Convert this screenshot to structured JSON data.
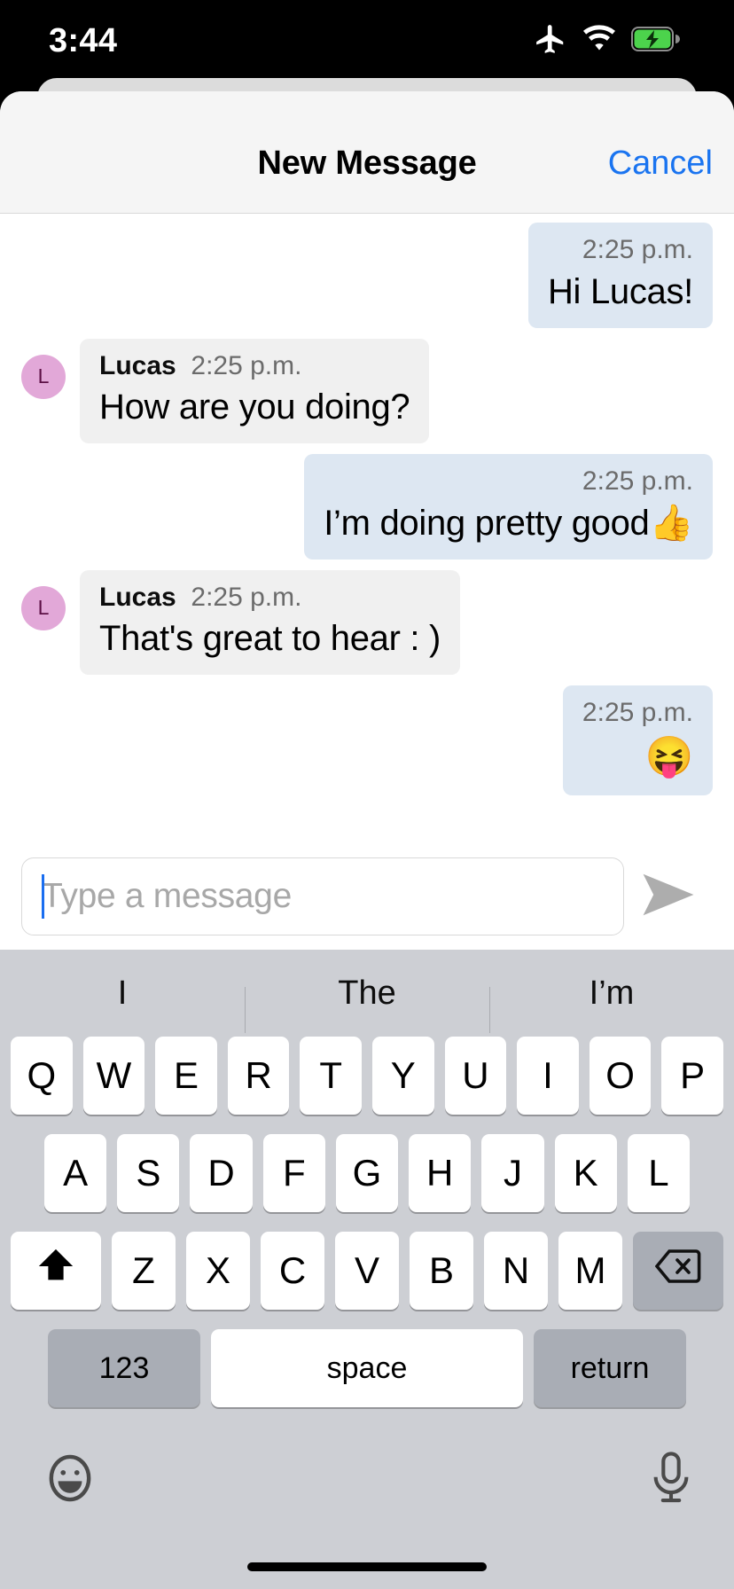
{
  "status_bar": {
    "time": "3:44",
    "icons": [
      "airplane-mode-icon",
      "wifi-icon",
      "battery-charging-icon"
    ]
  },
  "nav": {
    "title": "New Message",
    "cancel_label": "Cancel",
    "cancel_color": "#1a74f0"
  },
  "conversation": {
    "messages": [
      {
        "direction": "outgoing",
        "sender": "",
        "time": "2:25 p.m.",
        "text": "Hi Lucas!",
        "avatar": ""
      },
      {
        "direction": "incoming",
        "sender": "Lucas",
        "time": "2:25 p.m.",
        "text": "How are you doing?",
        "avatar": "L"
      },
      {
        "direction": "outgoing",
        "sender": "",
        "time": "2:25 p.m.",
        "text": "I’m doing pretty good👍",
        "avatar": ""
      },
      {
        "direction": "incoming",
        "sender": "Lucas",
        "time": "2:25 p.m.",
        "text": "That's great to hear : )",
        "avatar": "L"
      },
      {
        "direction": "outgoing",
        "sender": "",
        "time": "2:25 p.m.",
        "text": "😝",
        "avatar": ""
      }
    ],
    "outgoing_bubble_color": "#dde7f2",
    "incoming_bubble_color": "#f0f0f0",
    "avatar_color": "#e2a8d8",
    "avatar_text_color": "#5c1045"
  },
  "composer": {
    "placeholder": "Type a message",
    "value": "",
    "send_icon": "send-arrow-icon",
    "caret_color": "#1a6ef0"
  },
  "keyboard": {
    "suggestions": [
      "I",
      "The",
      "I’m"
    ],
    "row1": [
      "Q",
      "W",
      "E",
      "R",
      "T",
      "Y",
      "U",
      "I",
      "O",
      "P"
    ],
    "row2": [
      "A",
      "S",
      "D",
      "F",
      "G",
      "H",
      "J",
      "K",
      "L"
    ],
    "row3": [
      "Z",
      "X",
      "C",
      "V",
      "B",
      "N",
      "M"
    ],
    "shift_icon": "shift-up-arrow-icon",
    "backspace_icon": "backspace-delete-icon",
    "numbers_label": "123",
    "space_label": "space",
    "return_label": "return",
    "emoji_icon": "emoji-smiley-icon",
    "mic_icon": "microphone-icon",
    "background_color": "#cdcfd4",
    "key_color": "#ffffff",
    "modifier_key_color": "#a9adb5"
  }
}
